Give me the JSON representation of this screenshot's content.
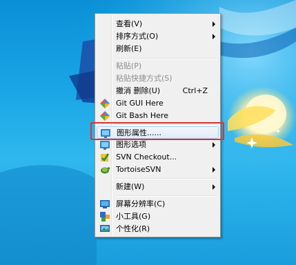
{
  "menu": {
    "items": [
      {
        "label": "查看(V)",
        "submenu": true
      },
      {
        "label": "排序方式(O)",
        "submenu": true
      },
      {
        "label": "刷新(E)"
      },
      {
        "label": "粘贴(P)",
        "disabled": true
      },
      {
        "label": "粘贴快捷方式(S)",
        "disabled": true
      },
      {
        "label": "撤消 删除(U)",
        "shortcut": "Ctrl+Z"
      },
      {
        "label": "Git GUI Here",
        "icon": "git-icon"
      },
      {
        "label": "Git Bash Here",
        "icon": "git-icon"
      },
      {
        "label": "图形属性......",
        "icon": "graphics-properties-icon"
      },
      {
        "label": "图形选项",
        "icon": "graphics-options-icon",
        "submenu": true
      },
      {
        "label": "SVN Checkout...",
        "icon": "svn-checkout-icon"
      },
      {
        "label": "TortoiseSVN",
        "icon": "tortoisesvn-icon",
        "submenu": true
      },
      {
        "label": "新建(W)",
        "submenu": true
      },
      {
        "label": "屏幕分辨率(C)",
        "icon": "screen-resolution-icon"
      },
      {
        "label": "小工具(G)",
        "icon": "gadgets-icon"
      },
      {
        "label": "个性化(R)",
        "icon": "personalize-icon"
      }
    ]
  },
  "colors": {
    "desktop_blue": "#1aa6e6",
    "highlight_red": "#d8342f",
    "menu_bg": "#f0f0f0"
  }
}
